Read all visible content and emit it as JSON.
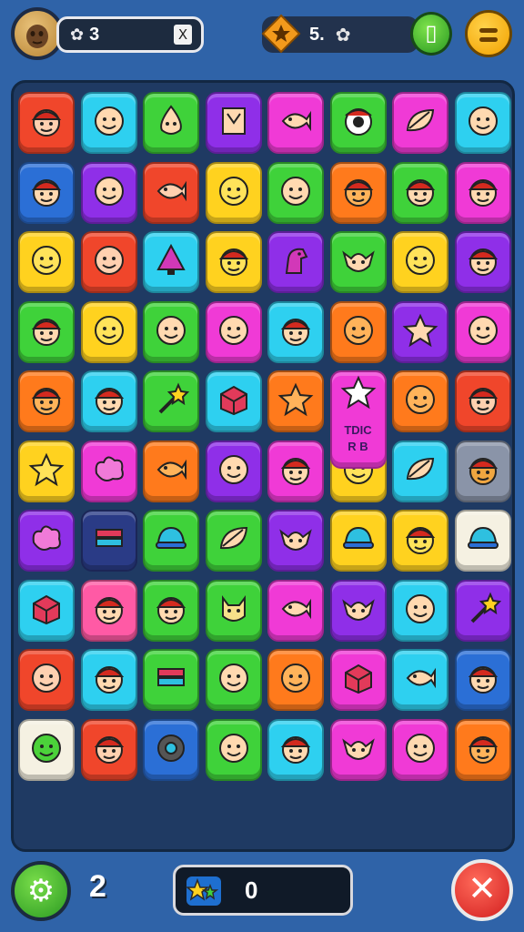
{
  "header": {
    "coin_count": "3",
    "coin_close_label": "X",
    "star_value": "5.",
    "icons": [
      "avatar-icon",
      "gear-icon",
      "star-badge-icon",
      "phone-icon",
      "menu-icon"
    ]
  },
  "footer": {
    "level": "2",
    "score": "0",
    "icons": [
      "settings-gear-icon",
      "star-pair-icon",
      "close-icon"
    ]
  },
  "tile_colors": {
    "red": "#f0462b",
    "orange": "#ff7a1c",
    "yellow": "#ffd21f",
    "green": "#3fd23a",
    "cyan": "#2ed0f0",
    "blue": "#2b6fd6",
    "purple": "#8f2fe8",
    "magenta": "#f03ad6",
    "pink": "#ff5aa5",
    "cream": "#f5f1e2",
    "gray": "#8a94a8",
    "navy": "#2a3b86"
  },
  "tiles": [
    {
      "color": "red",
      "face": "person"
    },
    {
      "color": "cyan",
      "face": "smile"
    },
    {
      "color": "green",
      "face": "drop"
    },
    {
      "color": "purple",
      "face": "frame"
    },
    {
      "color": "magenta",
      "face": "fish"
    },
    {
      "color": "green",
      "face": "eye"
    },
    {
      "color": "magenta",
      "face": "leaf"
    },
    {
      "color": "cyan",
      "face": "smile"
    },
    {
      "color": "blue",
      "face": "person"
    },
    {
      "color": "purple",
      "face": "smile"
    },
    {
      "color": "red",
      "face": "fish"
    },
    {
      "color": "yellow",
      "face": "smile"
    },
    {
      "color": "green",
      "face": "smile"
    },
    {
      "color": "orange",
      "face": "person"
    },
    {
      "color": "green",
      "face": "person"
    },
    {
      "color": "magenta",
      "face": "person"
    },
    {
      "color": "yellow",
      "face": "smile"
    },
    {
      "color": "red",
      "face": "smile"
    },
    {
      "color": "cyan",
      "face": "cone"
    },
    {
      "color": "yellow",
      "face": "person"
    },
    {
      "color": "purple",
      "face": "horse"
    },
    {
      "color": "green",
      "face": "goblin"
    },
    {
      "color": "yellow",
      "face": "smile"
    },
    {
      "color": "purple",
      "face": "person"
    },
    {
      "color": "green",
      "face": "person"
    },
    {
      "color": "yellow",
      "face": "smile"
    },
    {
      "color": "green",
      "face": "smile"
    },
    {
      "color": "magenta",
      "face": "smile"
    },
    {
      "color": "cyan",
      "face": "person"
    },
    {
      "color": "orange",
      "face": "smile"
    },
    {
      "color": "purple",
      "face": "star"
    },
    {
      "color": "magenta",
      "face": "smile"
    },
    {
      "color": "orange",
      "face": "person"
    },
    {
      "color": "cyan",
      "face": "person"
    },
    {
      "color": "green",
      "face": "wand"
    },
    {
      "color": "cyan",
      "face": "box"
    },
    {
      "color": "orange",
      "face": "star"
    },
    {
      "color": "magenta",
      "face": "star"
    },
    {
      "color": "orange",
      "face": "smile"
    },
    {
      "color": "red",
      "face": "person"
    },
    {
      "color": "yellow",
      "face": "star"
    },
    {
      "color": "magenta",
      "face": "splash"
    },
    {
      "color": "orange",
      "face": "fish"
    },
    {
      "color": "purple",
      "face": "smile"
    },
    {
      "color": "magenta",
      "face": "person"
    },
    {
      "color": "yellow",
      "face": "smile"
    },
    {
      "color": "cyan",
      "face": "leaf"
    },
    {
      "color": "gray",
      "face": "person"
    },
    {
      "color": "purple",
      "face": "splash"
    },
    {
      "color": "navy",
      "face": "book"
    },
    {
      "color": "green",
      "face": "cap"
    },
    {
      "color": "green",
      "face": "leaf"
    },
    {
      "color": "purple",
      "face": "goblin"
    },
    {
      "color": "yellow",
      "face": "cap"
    },
    {
      "color": "yellow",
      "face": "person"
    },
    {
      "color": "cream",
      "face": "cap"
    },
    {
      "color": "cyan",
      "face": "box"
    },
    {
      "color": "pink",
      "face": "person"
    },
    {
      "color": "green",
      "face": "person"
    },
    {
      "color": "green",
      "face": "cat"
    },
    {
      "color": "magenta",
      "face": "fish"
    },
    {
      "color": "purple",
      "face": "goblin"
    },
    {
      "color": "cyan",
      "face": "smile"
    },
    {
      "color": "purple",
      "face": "wand"
    },
    {
      "color": "red",
      "face": "smile"
    },
    {
      "color": "cyan",
      "face": "person"
    },
    {
      "color": "green",
      "face": "book"
    },
    {
      "color": "green",
      "face": "smile"
    },
    {
      "color": "orange",
      "face": "smile"
    },
    {
      "color": "magenta",
      "face": "box"
    },
    {
      "color": "cyan",
      "face": "fish"
    },
    {
      "color": "blue",
      "face": "person"
    },
    {
      "color": "cream",
      "face": "smile"
    },
    {
      "color": "red",
      "face": "person"
    },
    {
      "color": "blue",
      "face": "wheel"
    },
    {
      "color": "green",
      "face": "smile"
    },
    {
      "color": "cyan",
      "face": "person"
    },
    {
      "color": "magenta",
      "face": "goblin"
    },
    {
      "color": "magenta",
      "face": "smile"
    },
    {
      "color": "orange",
      "face": "person"
    }
  ],
  "tall_tile_text": [
    "TDIC",
    "R  B"
  ]
}
